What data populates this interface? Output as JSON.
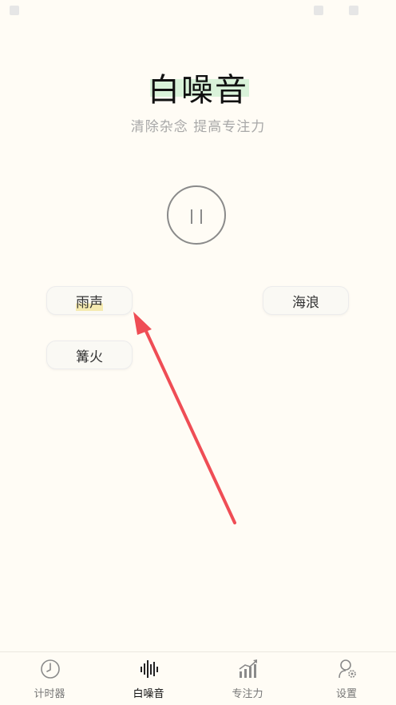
{
  "header": {
    "title": "白噪音",
    "subtitle": "清除杂念 提高专注力"
  },
  "player": {
    "state": "playing",
    "icon": "pause-icon"
  },
  "sounds": [
    {
      "label": "雨声",
      "active": true
    },
    {
      "label": "海浪",
      "active": false
    },
    {
      "label": "篝火",
      "active": false
    }
  ],
  "tabs": [
    {
      "label": "计时器",
      "icon": "clock-icon",
      "active": false
    },
    {
      "label": "白噪音",
      "icon": "sound-wave-icon",
      "active": true
    },
    {
      "label": "专注力",
      "icon": "chart-icon",
      "active": false
    },
    {
      "label": "设置",
      "icon": "settings-icon",
      "active": false
    }
  ],
  "colors": {
    "background": "#fffcf5",
    "title_highlight": "#d9f2d9",
    "annotation_arrow": "#ef4d55",
    "icon_gray": "#8a8a8a"
  }
}
